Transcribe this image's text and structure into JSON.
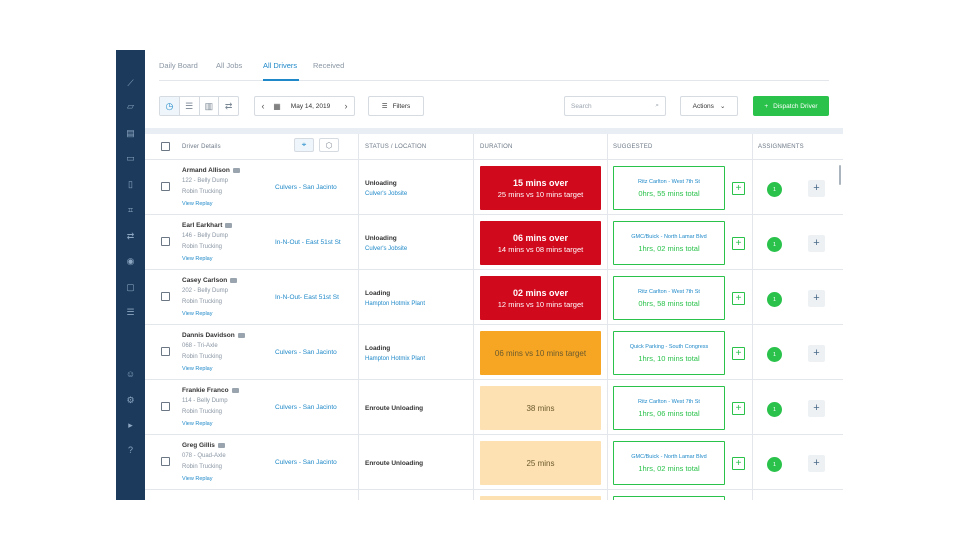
{
  "tabs": [
    {
      "label": "Daily Board"
    },
    {
      "label": "All Jobs"
    },
    {
      "label": "All Drivers"
    },
    {
      "label": "Received"
    }
  ],
  "toolbar": {
    "date": "May 14, 2019",
    "filters_label": "Filters",
    "search_placeholder": "Search",
    "actions_label": "Actions",
    "dispatch_label": "Dispatch Driver"
  },
  "columns": {
    "driver_details": "Driver Details",
    "status_location": "STATUS / LOCATION",
    "duration": "DURATION",
    "suggested": "SUGGESTED",
    "assignments": "ASSIGNMENTS"
  },
  "rows": [
    {
      "name": "Armand Allison",
      "truck": "122 - Belly Dump",
      "company": "Robin Trucking",
      "link": "View Replay",
      "location": "Culvers - San Jacinto",
      "status": "Unloading",
      "status_sub": "Culver's Jobsite",
      "dur_main": "15 mins over",
      "dur_sub": "25 mins vs 10 mins target",
      "dur_style": "red",
      "sugg_place": "Ritz Carlton - West 7th St",
      "sugg_time": "0hrs, 55 mins total",
      "assignments": "1"
    },
    {
      "name": "Earl Earkhart",
      "truck": "146 - Belly Dump",
      "company": "Robin Trucking",
      "link": "View Replay",
      "location": "In-N-Out - East 51st St",
      "status": "Unloading",
      "status_sub": "Culver's Jobsite",
      "dur_main": "06 mins over",
      "dur_sub": "14 mins vs 08 mins target",
      "dur_style": "red",
      "sugg_place": "GMC/Buick - North Lamar Blvd",
      "sugg_time": "1hrs, 02 mins total",
      "assignments": "1"
    },
    {
      "name": "Casey Carlson",
      "truck": "202 - Belly Dump",
      "company": "Robin Trucking",
      "link": "View Replay",
      "location": "In-N-Out- East 51st St",
      "status": "Loading",
      "status_sub": "Hampton Hotmix Plant",
      "dur_main": "02 mins over",
      "dur_sub": "12 mins vs 10 mins target",
      "dur_style": "red",
      "sugg_place": "Ritz Carlton - West 7th St",
      "sugg_time": "0hrs, 58 mins total",
      "assignments": "1"
    },
    {
      "name": "Dannis Davidson",
      "truck": "068 - Tri-Axle",
      "company": "Robin Trucking",
      "link": "View Replay",
      "location": "Culvers - San Jacinto",
      "status": "Loading",
      "status_sub": "Hampton Hotmix Plant",
      "dur_main": "06 mins vs 10 mins target",
      "dur_sub": "",
      "dur_style": "orange",
      "sugg_place": "Quick Parking - South Congress",
      "sugg_time": "1hrs, 10 mins total",
      "assignments": "1"
    },
    {
      "name": "Frankie Franco",
      "truck": "114 - Belly Dump",
      "company": "Robin Trucking",
      "link": "View Replay",
      "location": "Culvers - San Jacinto",
      "status": "Enroute Unloading",
      "status_sub": "",
      "dur_main": "38 mins",
      "dur_sub": "",
      "dur_style": "light",
      "sugg_place": "Ritz Carlton - West 7th St",
      "sugg_time": "1hrs, 06 mins total",
      "assignments": "1"
    },
    {
      "name": "Greg Gillis",
      "truck": "078 - Quad-Axle",
      "company": "Robin Trucking",
      "link": "View Replay",
      "location": "Culvers - San Jacinto",
      "status": "Enroute Unloading",
      "status_sub": "",
      "dur_main": "25 mins",
      "dur_sub": "",
      "dur_style": "light",
      "sugg_place": "GMC/Buick - North Lamar Blvd",
      "sugg_time": "1hrs, 02 mins total",
      "assignments": "1"
    }
  ]
}
